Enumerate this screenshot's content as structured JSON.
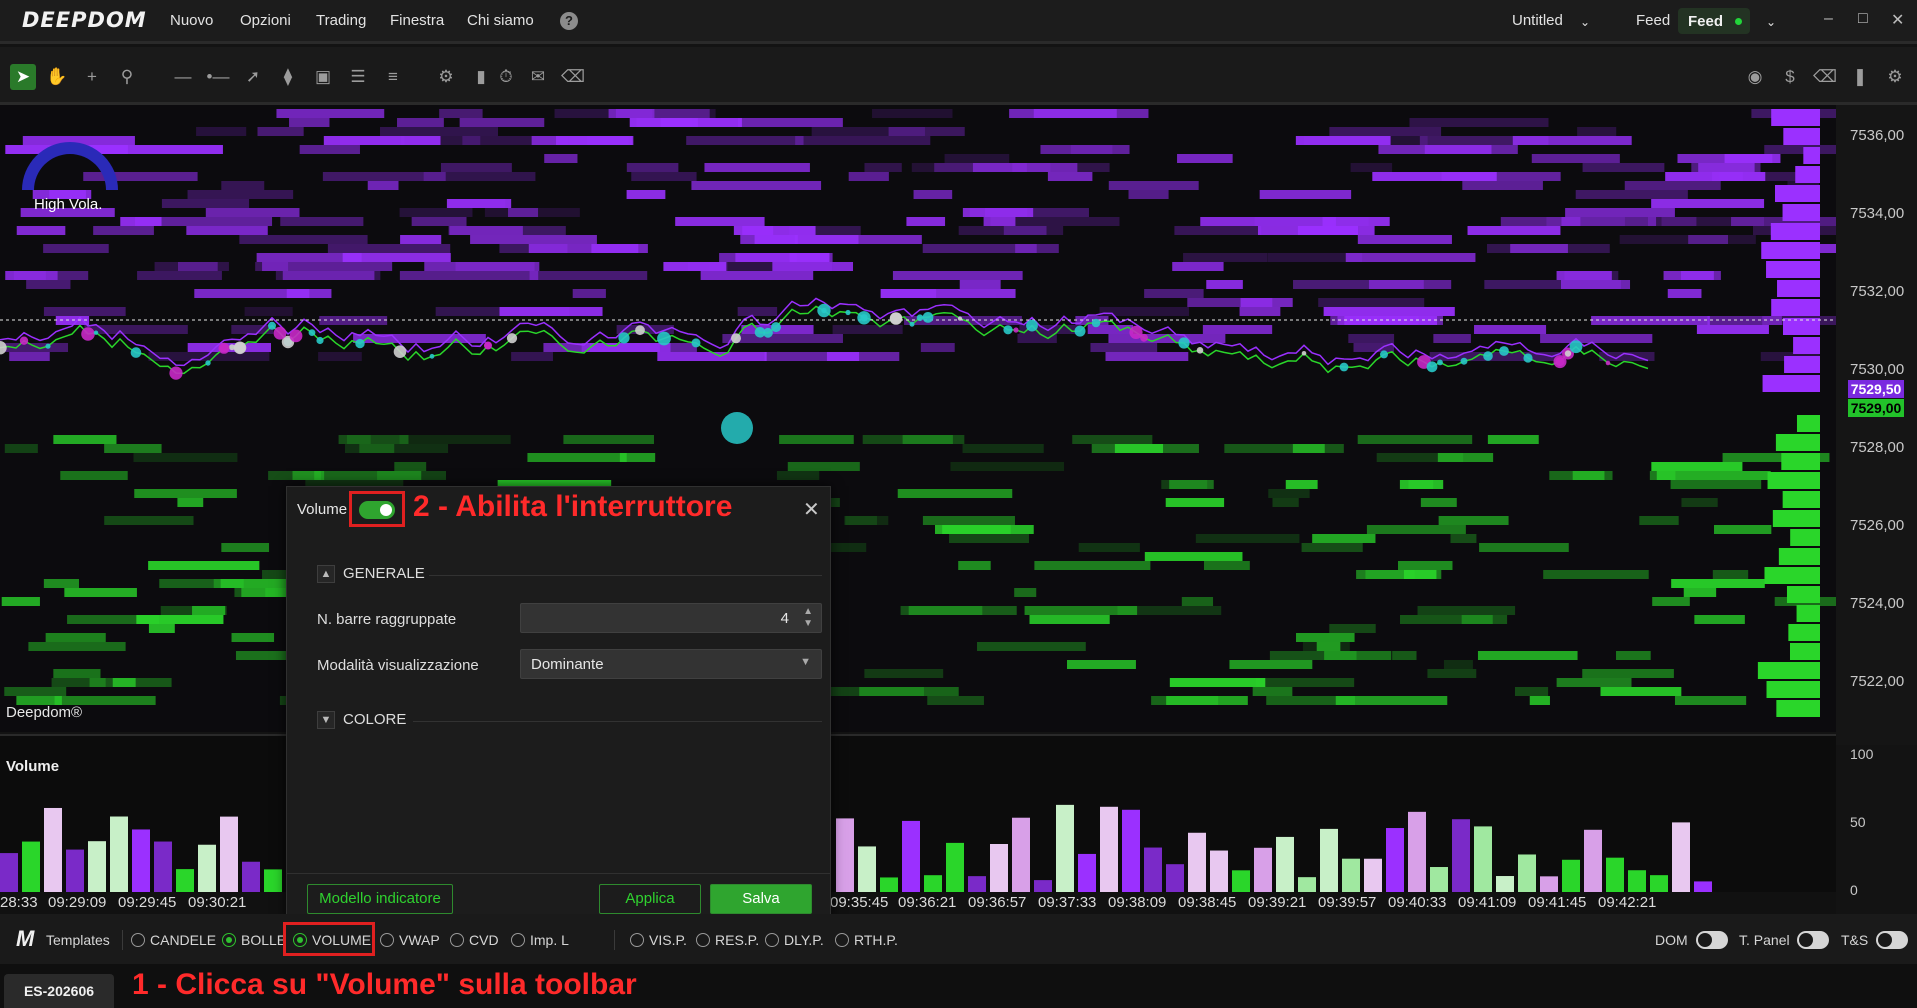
{
  "app": {
    "logo": "DEEPDOM"
  },
  "menu": {
    "items": [
      "Nuovo",
      "Opzioni",
      "Trading",
      "Finestra",
      "Chi siamo"
    ],
    "help_icon": "question-icon"
  },
  "header_right": {
    "workspace": "Untitled",
    "feed_label": "Feed",
    "feed_button": "Feed"
  },
  "toolbar": {
    "icons": [
      "cursor-icon",
      "hand-icon",
      "crosshair-icon",
      "zoom-icon",
      "hline-icon",
      "ray-icon",
      "trendline-icon",
      "path-icon",
      "rect-icon",
      "lines-icon",
      "fib-icon",
      "settings-sliders-icon",
      "bars-icon",
      "timer-icon",
      "comment-icon",
      "eraser-icon"
    ],
    "right_icons": [
      "camera-icon",
      "dollar-icon",
      "eraser-icon",
      "pause-icon",
      "gear-icon"
    ]
  },
  "chart": {
    "gauge_label": "High Vola.",
    "watermark": "Deepdom®",
    "price_labels": [
      "7536,00",
      "7534,00",
      "7532,00",
      "7530,00",
      "7528,00",
      "7526,00",
      "7524,00",
      "7522,00"
    ],
    "current_tags": {
      "ask": "7529,50",
      "bid": "7529,00"
    },
    "sell_depth": [
      "12",
      "17",
      "9",
      "79",
      "12",
      "12",
      "40",
      "13",
      "12",
      "21",
      "12",
      "16",
      "18",
      "31",
      "14"
    ],
    "buy_depth": [
      "17",
      "19",
      "18",
      "13",
      "13",
      "16",
      "16",
      "54",
      "14",
      "13",
      "62",
      "14",
      "13",
      "14",
      "11",
      "11"
    ],
    "colors": {
      "ask": "#9b30ff",
      "bid": "#2ad62a",
      "bubble_buy": "#28c8c8",
      "bubble_sell": "#c828c8"
    }
  },
  "volume": {
    "title": "Volume",
    "axis": [
      "100",
      "50",
      "0"
    ]
  },
  "time_labels": [
    "28:33",
    "09:29:09",
    "09:29:45",
    "09:30:21",
    "09:35:45",
    "09:36:21",
    "09:36:57",
    "09:37:33",
    "09:38:09",
    "09:38:45",
    "09:39:21",
    "09:39:57",
    "09:40:33",
    "09:41:09",
    "09:41:45",
    "09:42:21"
  ],
  "dialog": {
    "title": "Volume",
    "annotation2": "2 - Abilita l'interruttore",
    "section_general": "GENERALE",
    "field_bars": "N. barre raggruppate",
    "bars_value": "4",
    "field_mode": "Modalità visualizzazione",
    "mode_value": "Dominante",
    "section_color": "COLORE",
    "btn_template": "Modello indicatore",
    "btn_apply": "Applica",
    "btn_save": "Salva"
  },
  "bottombar": {
    "templates": "Templates",
    "options": [
      "CANDELE",
      "BOLLE",
      "VOLUME",
      "VWAP",
      "CVD",
      "Imp. L"
    ],
    "options2": [
      "VIS.P.",
      "RES.P.",
      "DLY.P.",
      "RTH.P."
    ],
    "toggles": [
      "DOM",
      "T. Panel",
      "T&S"
    ]
  },
  "tab": {
    "symbol": "ES-202606"
  },
  "annotation1": "1 - Clicca su \"Volume\" sulla toolbar"
}
